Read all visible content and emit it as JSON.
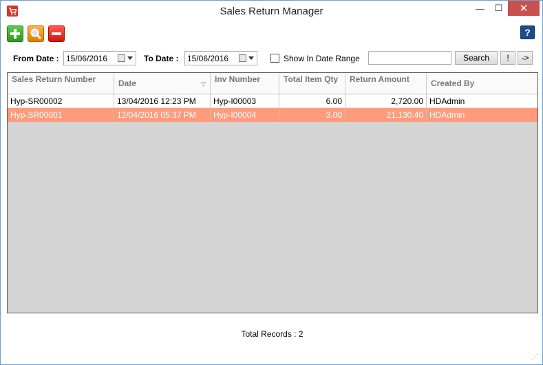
{
  "window": {
    "title": "Sales Return Manager",
    "minimize": "—",
    "maximize": "☐",
    "close": "✕"
  },
  "toolbar": {
    "add_icon": "plus-icon",
    "search_icon": "magnifier-icon",
    "delete_icon": "minus-icon",
    "help_label": "?"
  },
  "filters": {
    "from_label": "From Date :",
    "from_value": "15/06/2016",
    "to_label": "To Date :",
    "to_value": "15/06/2016",
    "range_label": "Show In Date Range",
    "range_checked": false,
    "search_value": "",
    "search_button": "Search",
    "bang_button": "!",
    "next_button": "->"
  },
  "grid": {
    "columns": [
      "Sales Return Number",
      "Date",
      "Inv Number",
      "Total Item Qty",
      "Return Amount",
      "Created By"
    ],
    "rows": [
      [
        "Hyp-SR00002",
        "13/04/2016 12:23 PM",
        "Hyp-I00003",
        "6.00",
        "2,720.00",
        "HDAdmin"
      ],
      [
        "Hyp-SR00001",
        "12/04/2016 05:37 PM",
        "Hyp-I00004",
        "3.00",
        "21,130.40",
        "HDAdmin"
      ]
    ],
    "selected_row": 1
  },
  "footer": {
    "total_records": "Total Records : 2"
  },
  "colors": {
    "selected_row": "#fd9b7c",
    "grid_bg": "#d4d4d4",
    "close_button": "#c75050"
  }
}
